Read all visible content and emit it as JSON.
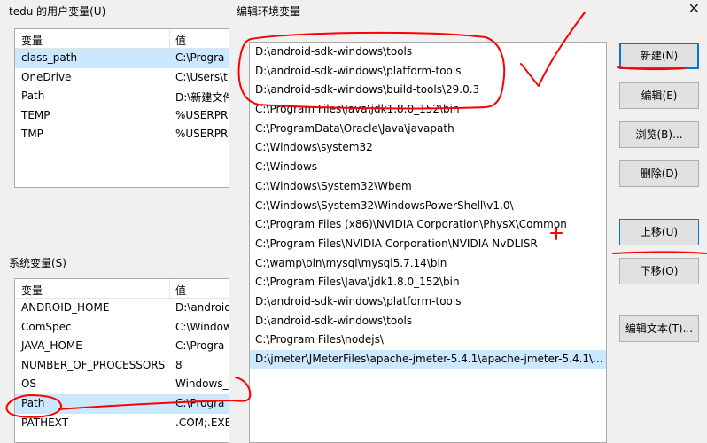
{
  "user_vars": {
    "title": "tedu 的用户变量(U)",
    "header": {
      "name": "变量",
      "value": "值"
    },
    "rows": [
      {
        "name": "class_path",
        "value": "C:\\Progra"
      },
      {
        "name": "OneDrive",
        "value": "C:\\Users\\t"
      },
      {
        "name": "Path",
        "value": "D:\\新建文件"
      },
      {
        "name": "TEMP",
        "value": "%USERPR"
      },
      {
        "name": "TMP",
        "value": "%USERPR"
      }
    ]
  },
  "system_vars": {
    "title": "系统变量(S)",
    "header": {
      "name": "变量",
      "value": "值"
    },
    "rows": [
      {
        "name": "ANDROID_HOME",
        "value": "D:\\android"
      },
      {
        "name": "ComSpec",
        "value": "C:\\Window"
      },
      {
        "name": "JAVA_HOME",
        "value": "C:\\Progra"
      },
      {
        "name": "NUMBER_OF_PROCESSORS",
        "value": "8"
      },
      {
        "name": "OS",
        "value": "Windows_"
      },
      {
        "name": "Path",
        "value": "C:\\Progra"
      },
      {
        "name": "PATHEXT",
        "value": ".COM;.EXE"
      }
    ]
  },
  "dialog": {
    "title": "编辑环境变量",
    "close_label": "✕",
    "paths": [
      "D:\\android-sdk-windows\\tools",
      "D:\\android-sdk-windows\\platform-tools",
      "D:\\android-sdk-windows\\build-tools\\29.0.3",
      "C:\\Program Files\\Java\\jdk1.8.0_152\\bin",
      "C:\\ProgramData\\Oracle\\Java\\javapath",
      "C:\\Windows\\system32",
      "C:\\Windows",
      "C:\\Windows\\System32\\Wbem",
      "C:\\Windows\\System32\\WindowsPowerShell\\v1.0\\",
      "C:\\Program Files (x86)\\NVIDIA Corporation\\PhysX\\Common",
      "C:\\Program Files\\NVIDIA Corporation\\NVIDIA NvDLISR",
      "C:\\wamp\\bin\\mysql\\mysql5.7.14\\bin",
      "C:\\Program Files\\Java\\jdk1.8.0_152\\bin",
      "D:\\android-sdk-windows\\platform-tools",
      "D:\\android-sdk-windows\\tools",
      "C:\\Program Files\\nodejs\\",
      "D:\\jmeter\\JMeterFiles\\apache-jmeter-5.4.1\\apache-jmeter-5.4.1\\..."
    ],
    "buttons": {
      "new": "新建(N)",
      "edit": "编辑(E)",
      "browse": "浏览(B)...",
      "delete": "删除(D)",
      "move_up": "上移(U)",
      "move_down": "下移(O)",
      "edit_text": "编辑文本(T)..."
    }
  },
  "colors": {
    "selection": "#cce8ff",
    "accent": "#0078d7",
    "annotation": "#ff0000"
  }
}
